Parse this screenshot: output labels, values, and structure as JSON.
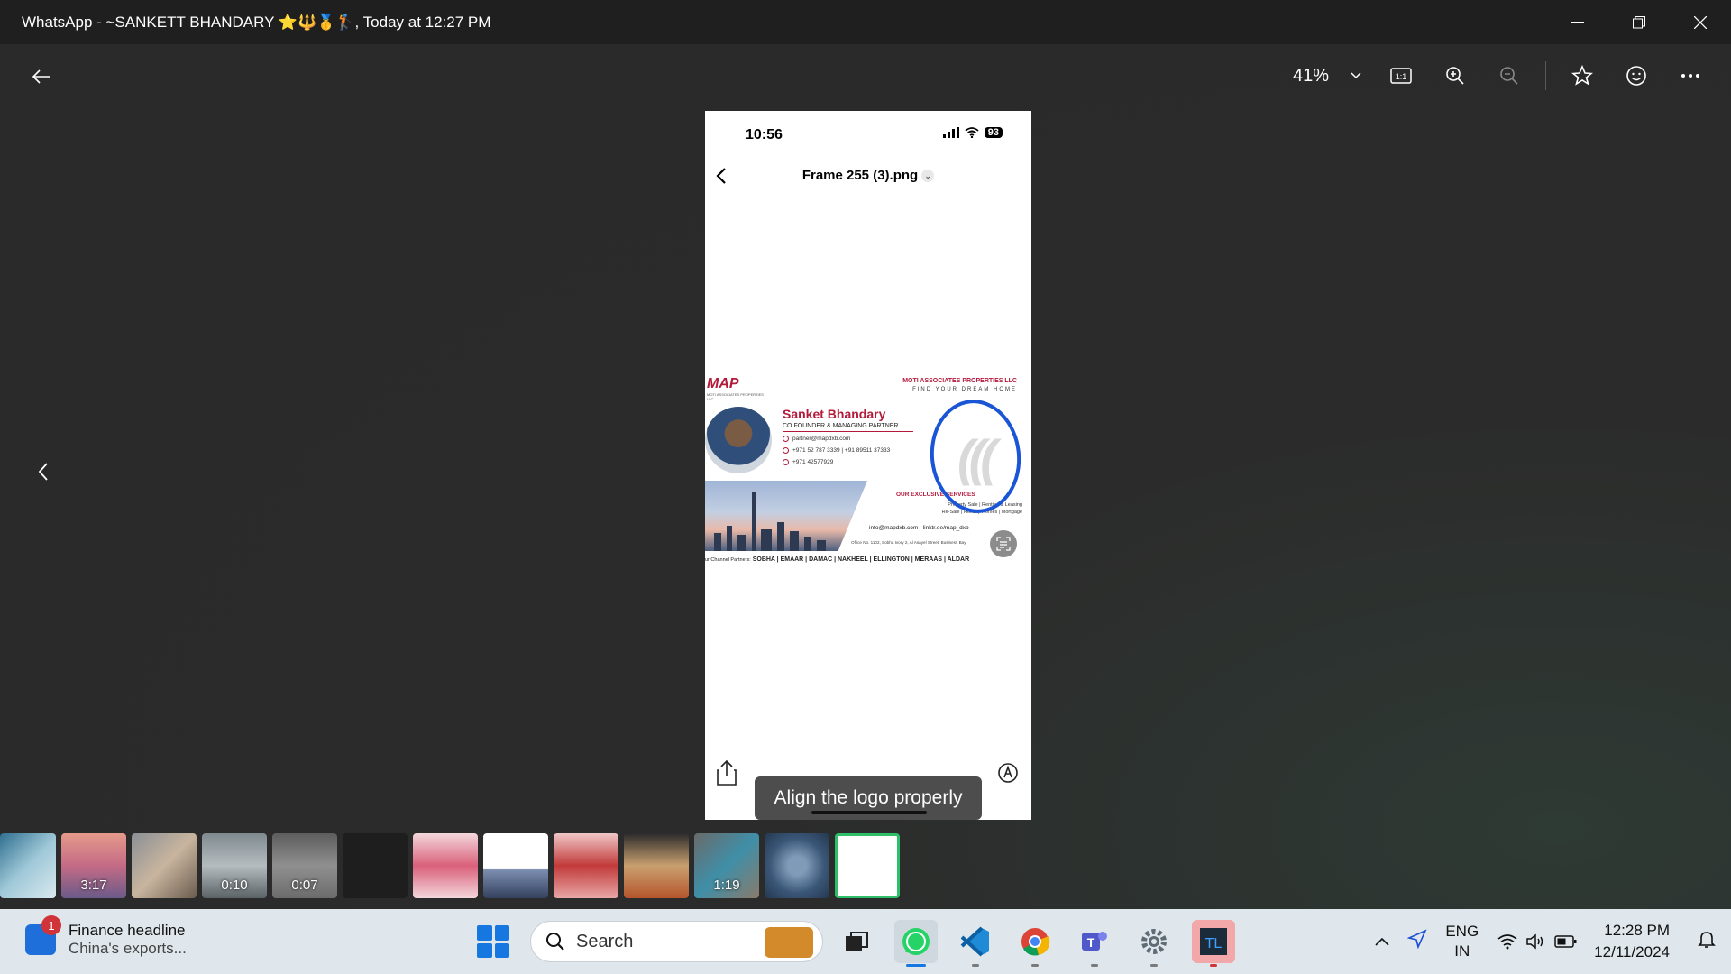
{
  "window": {
    "title": "WhatsApp - ~SANKETT BHANDARY ⭐🔱🥇🏌️, Today at 12:27 PM"
  },
  "toolbar": {
    "zoom": "41%"
  },
  "phone": {
    "time": "10:56",
    "battery": "93",
    "file_title": "Frame 255 (3).png"
  },
  "card": {
    "logo_text": "MAP",
    "logo_sub": "MOTI ASSOCIATES PROPERTIES LLC",
    "company": "MOTI ASSOCIATES PROPERTIES LLC",
    "tagline": "FIND YOUR DREAM HOME",
    "name": "Sanket Bhandary",
    "role": "CO FOUNDER & MANAGING PARTNER",
    "email": "partner@mapdxb.com",
    "phone": "+971 52 787 3339 | +91 89511 37333",
    "landline": "+971 42577929",
    "services_title": "OUR EXCLUSIVE SERVICES",
    "services_line1": "Property Sale | Renting & Leasing",
    "services_line2": "Re-Sale | Holiday Homes | Mortgage",
    "info_email": "info@mapdxb.com",
    "info_link": "linktr.ee/map_dxb",
    "office": "Office No. 1102, Sobha Ivory 2, Al Asayel Street, Business Bay",
    "partners_label": "ur Channel Partners:",
    "partners": "SOBHA | EMAAR | DAMAC | NAKHEEL | ELLINGTON | MERAAS | ALDAR"
  },
  "caption": "Align the logo properly",
  "filmstrip": {
    "durations": [
      "",
      "3:17",
      "",
      "0:10",
      "0:07",
      "",
      "",
      "",
      "",
      "",
      "1:19",
      "",
      ""
    ]
  },
  "taskbar": {
    "news_badge": "1",
    "news_title": "Finance headline",
    "news_sub": "China's exports...",
    "search_placeholder": "Search",
    "lang": "ENG",
    "region": "IN",
    "time": "12:28 PM",
    "date": "12/11/2024"
  },
  "colors": {
    "brand_red": "#b3193b",
    "annotation_blue": "#1a55d6",
    "selected_thumb": "#2fbf6a"
  }
}
